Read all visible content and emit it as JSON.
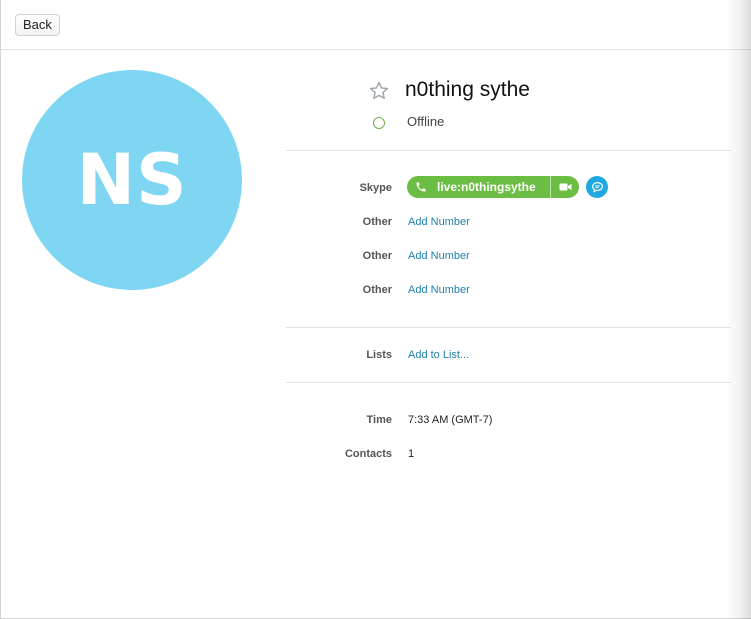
{
  "toolbar": {
    "back_label": "Back"
  },
  "profile": {
    "initials": "NS",
    "name": "n0thing sythe",
    "status": "Offline",
    "avatar_color": "#7fd6f3",
    "status_color": "#6cb04a"
  },
  "contact": {
    "skype_label": "Skype",
    "skype_id": "live:n0thingsythe",
    "call_color": "#6cbd43",
    "chat_color": "#20a9e0",
    "numbers": [
      {
        "label": "Other",
        "action": "Add Number"
      },
      {
        "label": "Other",
        "action": "Add Number"
      },
      {
        "label": "Other",
        "action": "Add Number"
      }
    ]
  },
  "lists": {
    "label": "Lists",
    "action": "Add to List..."
  },
  "info": {
    "time_label": "Time",
    "time_value": "7:33 AM (GMT-7)",
    "contacts_label": "Contacts",
    "contacts_value": "1"
  },
  "icons": {
    "star": "star-outline-icon",
    "status": "status-ring-icon",
    "phone": "phone-icon",
    "video": "video-camera-icon",
    "chat": "chat-bubble-icon"
  }
}
